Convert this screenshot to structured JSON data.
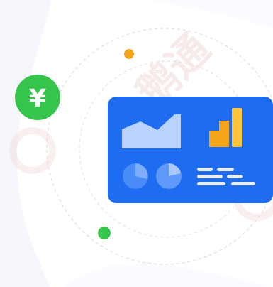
{
  "badge": {
    "symbol": "¥",
    "icon": "yen-icon"
  },
  "colors": {
    "accent_green": "#35C54A",
    "accent_orange": "#F4A51C",
    "card_blue": "#1E6CF0",
    "card_light": "#B9D2FF",
    "watermark": "#F3D9D9",
    "dash_ring": "#D9D9D9"
  },
  "watermark": {
    "text": "小鹅通"
  }
}
